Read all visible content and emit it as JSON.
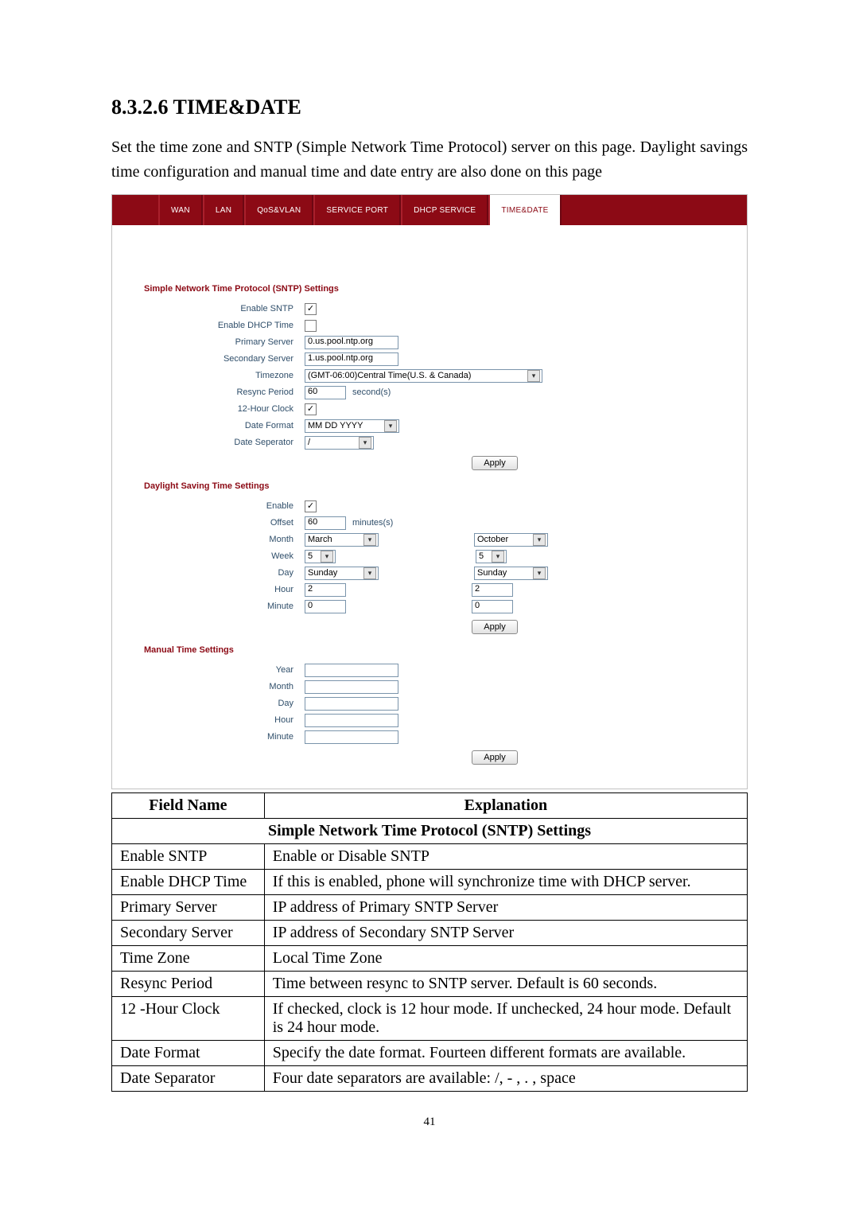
{
  "heading": "8.3.2.6   TIME&DATE",
  "intro": "Set the time zone and SNTP (Simple Network Time Protocol) server on this page.    Daylight savings time configuration and manual time and date entry are also done on this page",
  "tabs": [
    "WAN",
    "LAN",
    "QoS&VLAN",
    "SERVICE PORT",
    "DHCP SERVICE",
    "TIME&DATE"
  ],
  "active_tab": 5,
  "sntp": {
    "title": "Simple Network Time Protocol (SNTP) Settings",
    "enable_sntp_label": "Enable SNTP",
    "enable_sntp_checked": true,
    "enable_dhcp_label": "Enable DHCP Time",
    "enable_dhcp_checked": false,
    "primary_label": "Primary Server",
    "primary_value": "0.us.pool.ntp.org",
    "secondary_label": "Secondary Server",
    "secondary_value": "1.us.pool.ntp.org",
    "timezone_label": "Timezone",
    "timezone_value": "(GMT-06:00)Central Time(U.S. & Canada)",
    "resync_label": "Resync Period",
    "resync_value": "60",
    "resync_suffix": "second(s)",
    "twelve_label": "12-Hour Clock",
    "twelve_checked": true,
    "datefmt_label": "Date Format",
    "datefmt_value": "MM DD YYYY",
    "datesep_label": "Date Seperator",
    "datesep_value": "/"
  },
  "dst": {
    "title": "Daylight Saving Time Settings",
    "enable_label": "Enable",
    "enable_checked": true,
    "offset_label": "Offset",
    "offset_value": "60",
    "offset_suffix": "minutes(s)",
    "month_label": "Month",
    "month_start": "March",
    "month_end": "October",
    "week_label": "Week",
    "week_start": "5",
    "week_end": "5",
    "day_label": "Day",
    "day_start": "Sunday",
    "day_end": "Sunday",
    "hour_label": "Hour",
    "hour_start": "2",
    "hour_end": "2",
    "minute_label": "Minute",
    "minute_start": "0",
    "minute_end": "0"
  },
  "manual": {
    "title": "Manual Time Settings",
    "year_label": "Year",
    "month_label": "Month",
    "day_label": "Day",
    "hour_label": "Hour",
    "minute_label": "Minute"
  },
  "apply_label": "Apply",
  "table": {
    "head_field": "Field Name",
    "head_expl": "Explanation",
    "subhead": "Simple Network Time Protocol (SNTP) Settings",
    "rows": [
      {
        "f": "Enable SNTP",
        "e": "Enable or Disable SNTP"
      },
      {
        "f": "Enable DHCP Time",
        "e": "If this is enabled, phone will synchronize time with DHCP server."
      },
      {
        "f": "Primary Server",
        "e": "IP address of Primary SNTP Server"
      },
      {
        "f": "Secondary Server",
        "e": "IP address of Secondary SNTP Server"
      },
      {
        "f": "Time Zone",
        "e": "Local Time Zone"
      },
      {
        "f": "Resync Period",
        "e": "Time between resync to SNTP server. Default is 60 seconds."
      },
      {
        "f": "12 -Hour Clock",
        "e": "If checked, clock is 12 hour mode. If unchecked, 24 hour mode. Default is 24 hour mode."
      },
      {
        "f": "Date Format",
        "e": "Specify the date format. Fourteen different formats are available."
      },
      {
        "f": "Date Separator",
        "e": "Four date separators are available: /, - , . , space"
      }
    ]
  },
  "page_number": "41"
}
